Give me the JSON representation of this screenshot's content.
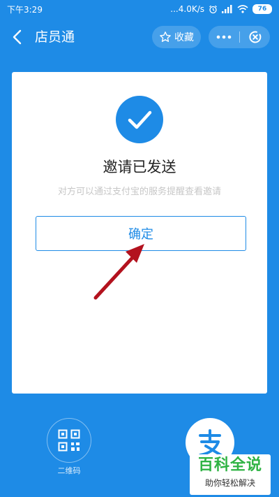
{
  "status_bar": {
    "time": "下午3:29",
    "network_speed": "...4.0K/s",
    "battery": "76"
  },
  "header": {
    "title": "店员通",
    "favorite_label": "收藏"
  },
  "dialog": {
    "title": "邀请已发送",
    "subtitle": "对方可以通过支付宝的服务提醒查看邀请",
    "confirm_label": "确定"
  },
  "bottom": {
    "qr_label": "二维码"
  },
  "watermark": {
    "main": "百科全说",
    "sub": "助你轻松解决"
  },
  "colors": {
    "brand_blue": "#1E8BE6",
    "arrow_red": "#B3121E",
    "watermark_green": "#2FB344"
  }
}
